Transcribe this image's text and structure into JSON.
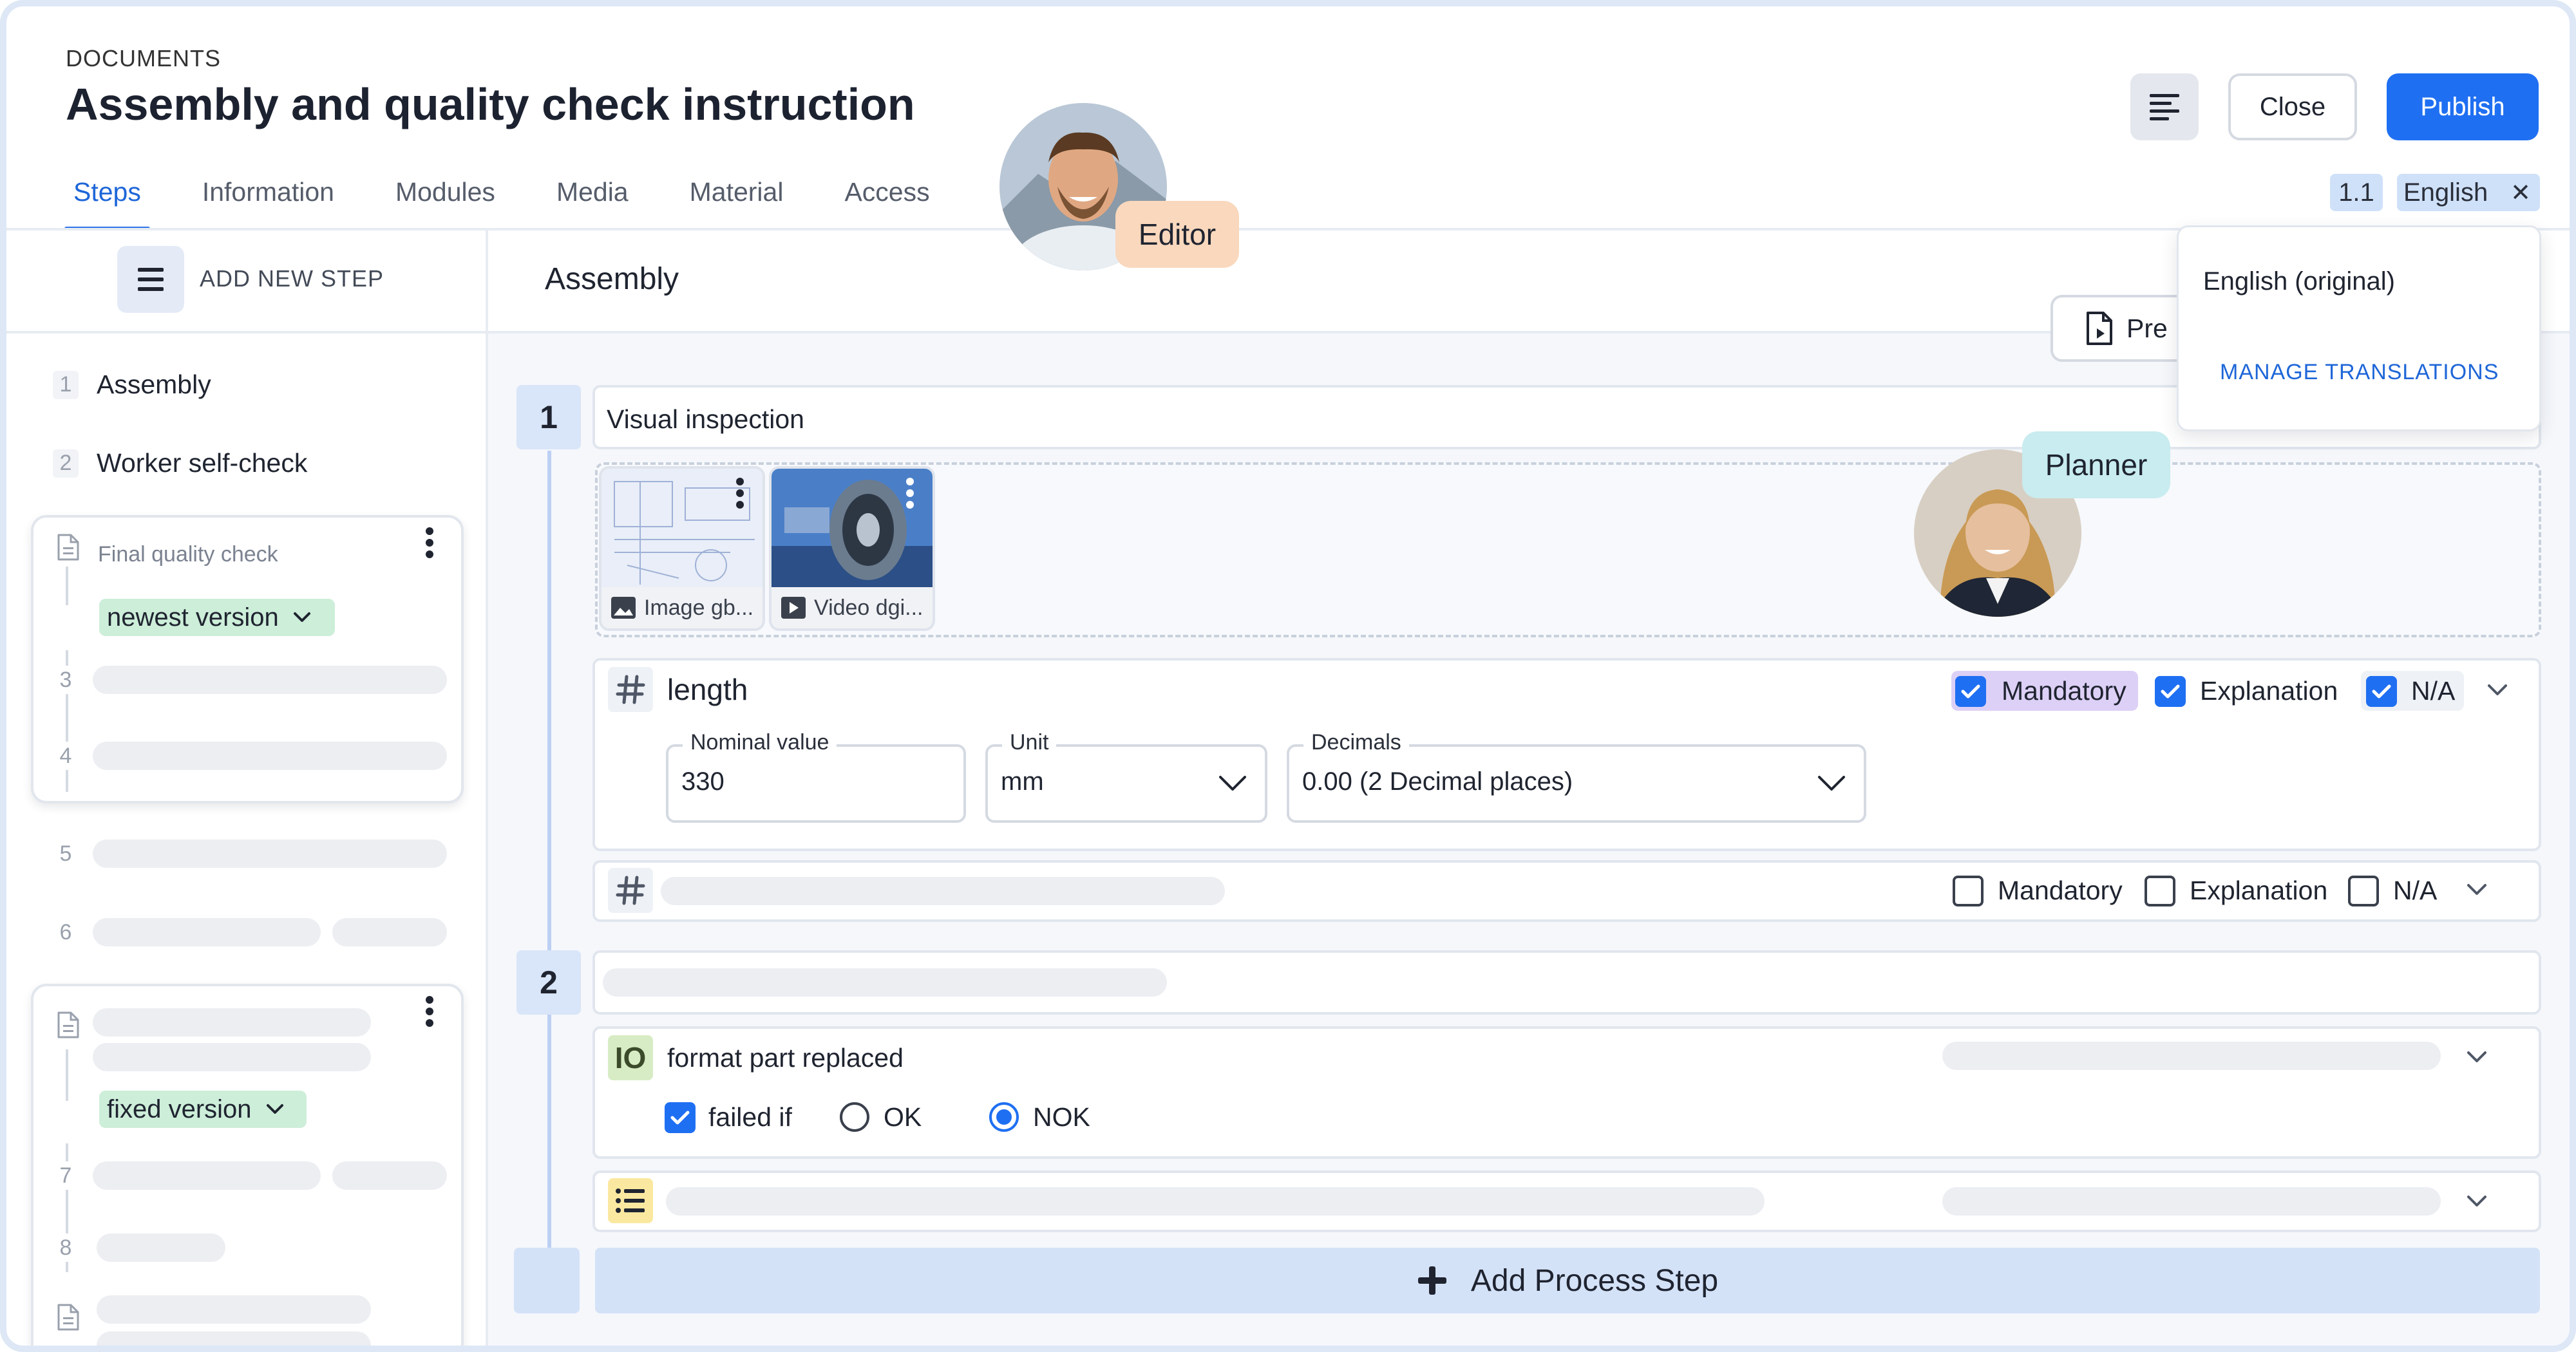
{
  "header": {
    "section_label": "DOCUMENTS",
    "title": "Assembly and quality check instruction",
    "close_label": "Close",
    "publish_label": "Publish",
    "version": "1.1",
    "language": "English"
  },
  "tabs": [
    {
      "label": "Steps",
      "active": true
    },
    {
      "label": "Information"
    },
    {
      "label": "Modules"
    },
    {
      "label": "Media"
    },
    {
      "label": "Material"
    },
    {
      "label": "Access"
    }
  ],
  "language_menu": {
    "original": "English (original)",
    "manage": "MANAGE TRANSLATIONS"
  },
  "preview_button": "Pre",
  "sidebar": {
    "add_step_label": "ADD NEW STEP",
    "steps": [
      {
        "num": "1",
        "label": "Assembly"
      },
      {
        "num": "2",
        "label": "Worker self-check"
      }
    ],
    "card1": {
      "title": "Final quality check",
      "version_pill": "newest version",
      "nums": [
        "3",
        "4"
      ]
    },
    "more_nums": [
      "5",
      "6"
    ],
    "card2": {
      "version_pill": "fixed version",
      "nums": [
        "7",
        "8"
      ]
    }
  },
  "main": {
    "section_title": "Assembly",
    "step1": {
      "num": "1",
      "title": "Visual inspection",
      "media": [
        {
          "caption": "Image gb...",
          "type": "image"
        },
        {
          "caption": "Video dgi...",
          "type": "video"
        }
      ],
      "check_length": {
        "name": "length",
        "mandatory": "Mandatory",
        "explanation": "Explanation",
        "na": "N/A",
        "nominal_label": "Nominal value",
        "nominal_value": "330",
        "unit_label": "Unit",
        "unit_value": "mm",
        "decimals_label": "Decimals",
        "decimals_value": "0.00 (2 Decimal places)"
      },
      "check_empty": {
        "mandatory": "Mandatory",
        "explanation": "Explanation",
        "na": "N/A"
      }
    },
    "step2": {
      "num": "2",
      "io_check": {
        "badge": "IO",
        "name": "format part replaced",
        "failed_if": "failed if",
        "ok": "OK",
        "nok": "NOK"
      }
    },
    "add_process_step": "Add Process Step"
  },
  "collaborators": [
    {
      "label": "Editor",
      "color": "#f9d8bd"
    },
    {
      "label": "Planner",
      "color": "#c8ecef"
    }
  ],
  "colors": {
    "accent": "#1f6ff2",
    "mandatory_bg": "#ddd0f6",
    "pill_green": "#cdeed9",
    "io_badge": "#d7ecc4",
    "list_badge": "#fbe8a0"
  }
}
